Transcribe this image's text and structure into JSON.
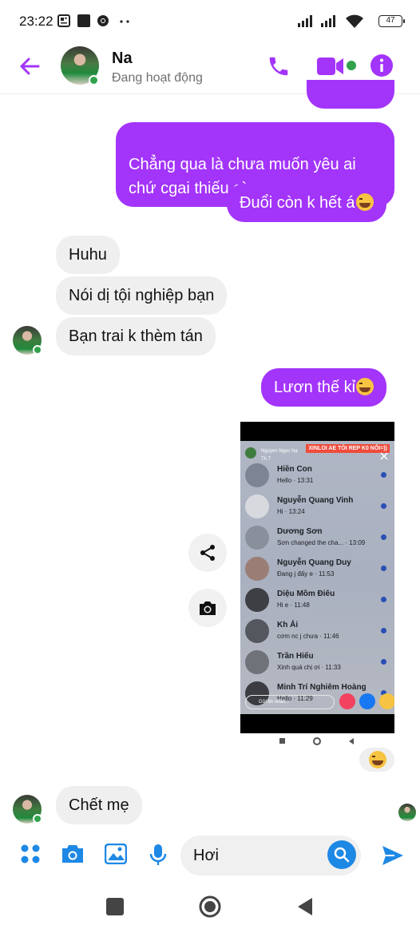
{
  "status_bar": {
    "time": "23:22",
    "battery": "47"
  },
  "header": {
    "contact_name": "Na",
    "contact_status": "Đang hoạt động",
    "accent_color": "#a334fa"
  },
  "messages": [
    {
      "direction": "outgoing",
      "text": "Chẳng qua là chưa muốn yêu ai\nchứ cgai thiếu gì"
    },
    {
      "direction": "outgoing",
      "text": "Đuổi còn k hết á",
      "emoji": "grinning-sweat"
    },
    {
      "direction": "incoming",
      "text": "Huhu"
    },
    {
      "direction": "incoming",
      "text": "Nói dị tội nghiệp bạn"
    },
    {
      "direction": "incoming",
      "text": "Bạn trai k thèm tán"
    },
    {
      "direction": "outgoing",
      "text": "Lươn thế kỉ",
      "emoji": "rolling-laughing"
    },
    {
      "direction": "outgoing",
      "type": "image"
    },
    {
      "direction": "outgoing",
      "type": "reaction",
      "emoji": "laughing"
    },
    {
      "direction": "incoming",
      "text": "Chết mẹ"
    }
  ],
  "shared_screenshot": {
    "profile_name": "Nguyen Ngọc Na",
    "date": "Th 7",
    "banner": "XINLOI AE TÔI REP K0 NỔI=))",
    "chats": [
      {
        "name": "Hiền Con",
        "preview": "Hello · 13:31"
      },
      {
        "name": "Nguyễn Quang Vinh",
        "preview": "Hi · 13:24"
      },
      {
        "name": "Dương Sơn",
        "preview": "Sơn changed the cha... · 13:09"
      },
      {
        "name": "Nguyễn Quang Duy",
        "preview": "Đang j đấy e · 11:53"
      },
      {
        "name": "Diệu Mồm Điêu",
        "preview": "Hi e · 11:48"
      },
      {
        "name": "Kh Ải",
        "preview": "cơm nc j chưa · 11:46"
      },
      {
        "name": "Trần Hiếu",
        "preview": "Xinh quá chị ơi · 11:33"
      },
      {
        "name": "Minh Trí Nghiêm Hoàng",
        "preview": "Hello · 11:29"
      }
    ],
    "comment_placeholder": "Gửi tin nhắn..."
  },
  "composer": {
    "input_value": "Hơi"
  }
}
